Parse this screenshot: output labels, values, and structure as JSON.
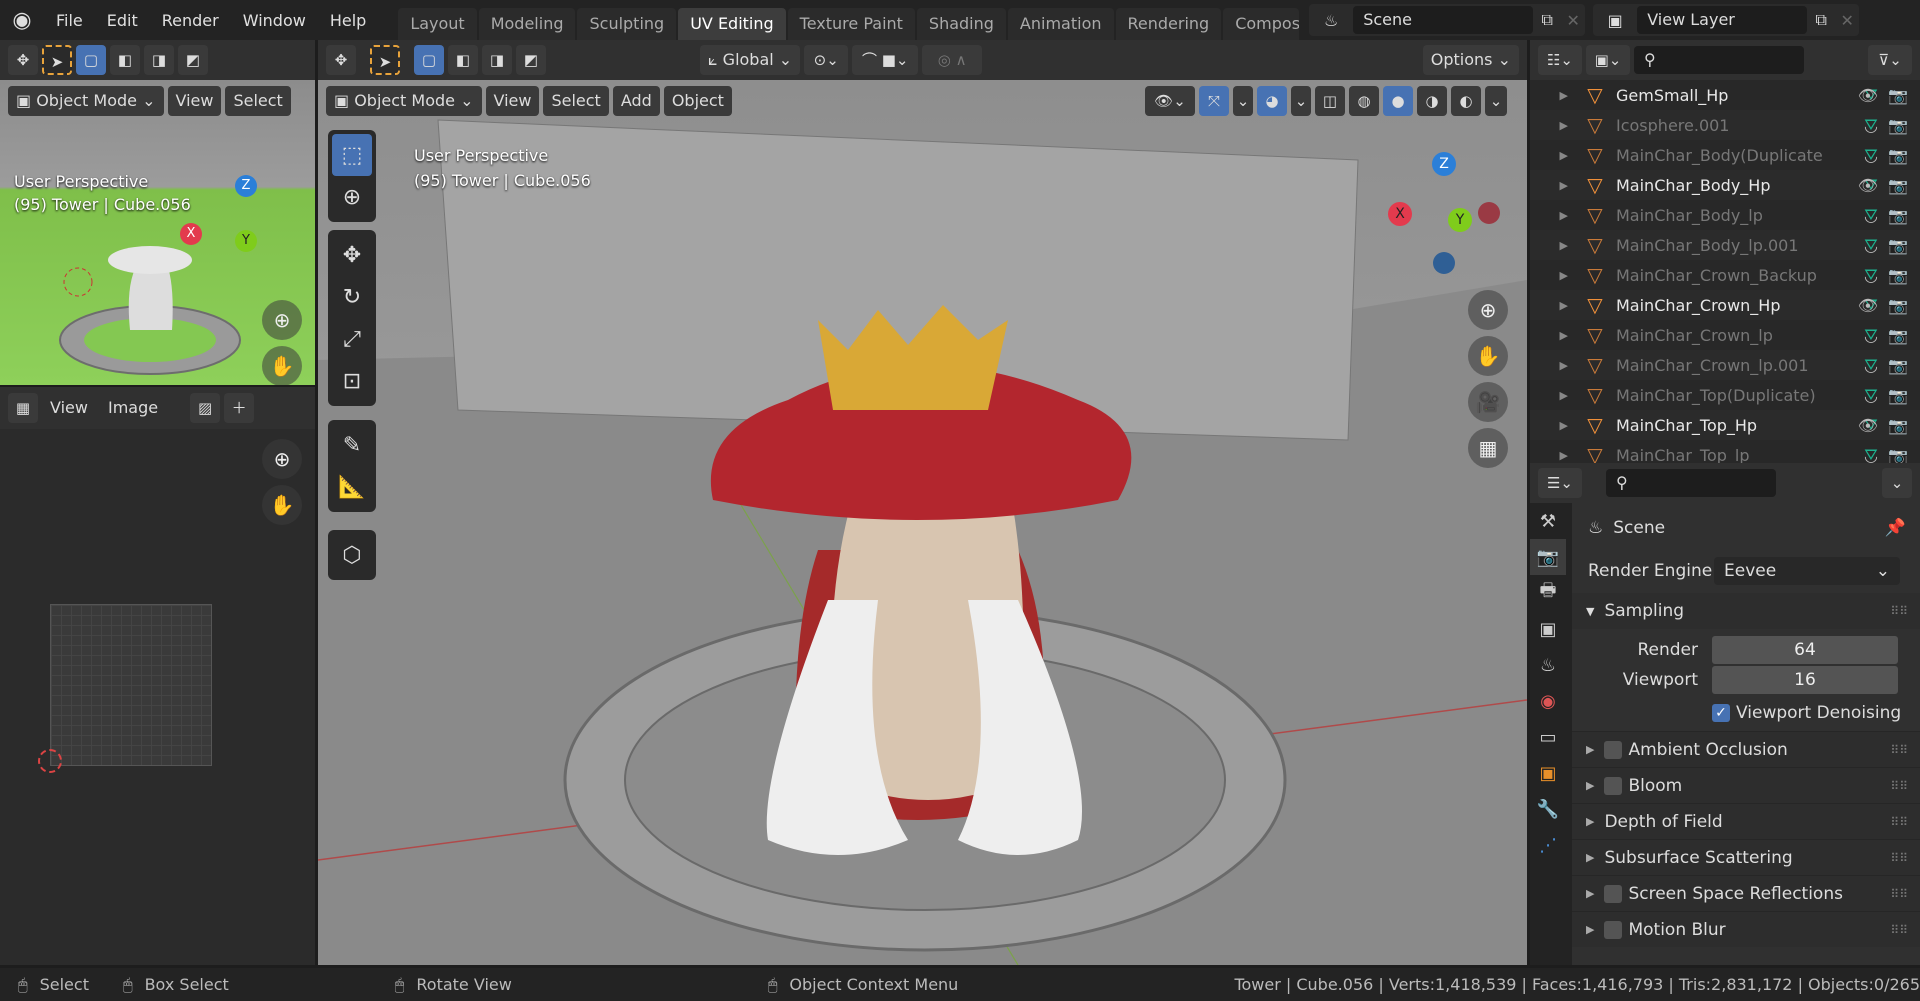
{
  "menu": [
    "File",
    "Edit",
    "Render",
    "Window",
    "Help"
  ],
  "workspaces": [
    {
      "label": "Layout"
    },
    {
      "label": "Modeling"
    },
    {
      "label": "Sculpting"
    },
    {
      "label": "UV Editing",
      "active": true
    },
    {
      "label": "Texture Paint"
    },
    {
      "label": "Shading"
    },
    {
      "label": "Animation"
    },
    {
      "label": "Rendering"
    },
    {
      "label": "Compos"
    }
  ],
  "scene": "Scene",
  "view_layer": "View Layer",
  "left_viewport": {
    "mode": "Object Mode",
    "view": "View",
    "select": "Select",
    "overlay_line1": "User Perspective",
    "overlay_line2": "(95) Tower | Cube.056"
  },
  "uv_editor": {
    "view": "View",
    "image": "Image"
  },
  "main_viewport": {
    "orientation": "Global",
    "options": "Options",
    "mode": "Object Mode",
    "menus": [
      "View",
      "Select",
      "Add",
      "Object"
    ],
    "overlay_line1": "User Perspective",
    "overlay_line2": "(95) Tower | Cube.056",
    "gizmo": {
      "x": "X",
      "y": "Y",
      "z": "Z"
    }
  },
  "outliner": {
    "items": [
      {
        "name": "GemSmall_Hp",
        "visible": true
      },
      {
        "name": "Icosphere.001",
        "visible": false
      },
      {
        "name": "MainChar_Body(Duplicate",
        "visible": false
      },
      {
        "name": "MainChar_Body_Hp",
        "visible": true
      },
      {
        "name": "MainChar_Body_lp",
        "visible": false
      },
      {
        "name": "MainChar_Body_lp.001",
        "visible": false
      },
      {
        "name": "MainChar_Crown_Backup",
        "visible": false
      },
      {
        "name": "MainChar_Crown_Hp",
        "visible": true
      },
      {
        "name": "MainChar_Crown_lp",
        "visible": false
      },
      {
        "name": "MainChar_Crown_lp.001",
        "visible": false
      },
      {
        "name": "MainChar_Top(Duplicate)",
        "visible": false
      },
      {
        "name": "MainChar_Top_Hp",
        "visible": true
      },
      {
        "name": "MainChar_Top_lp",
        "visible": false
      }
    ]
  },
  "properties": {
    "context": "Scene",
    "render_engine_label": "Render Engine",
    "render_engine": "Eevee",
    "sampling": "Sampling",
    "render_label": "Render",
    "render_value": "64",
    "viewport_label": "Viewport",
    "viewport_value": "16",
    "viewport_denoising": "Viewport Denoising",
    "viewport_denoising_checked": true,
    "panels": [
      {
        "label": "Ambient Occlusion",
        "checkbox": true
      },
      {
        "label": "Bloom",
        "checkbox": true
      },
      {
        "label": "Depth of Field",
        "checkbox": false
      },
      {
        "label": "Subsurface Scattering",
        "checkbox": false
      },
      {
        "label": "Screen Space Reflections",
        "checkbox": true
      },
      {
        "label": "Motion Blur",
        "checkbox": true
      }
    ]
  },
  "status": {
    "select": "Select",
    "box_select": "Box Select",
    "rotate_view": "Rotate View",
    "context_menu": "Object Context Menu",
    "stats": "Tower | Cube.056 | Verts:1,418,539 | Faces:1,416,793 | Tris:2,831,172 | Objects:0/265"
  },
  "colors": {
    "accent": "#4772b3",
    "object_orange": "#f0903a",
    "axis_x": "#e33a4d",
    "axis_y": "#7fcc1b",
    "axis_z": "#2b7fd8"
  }
}
